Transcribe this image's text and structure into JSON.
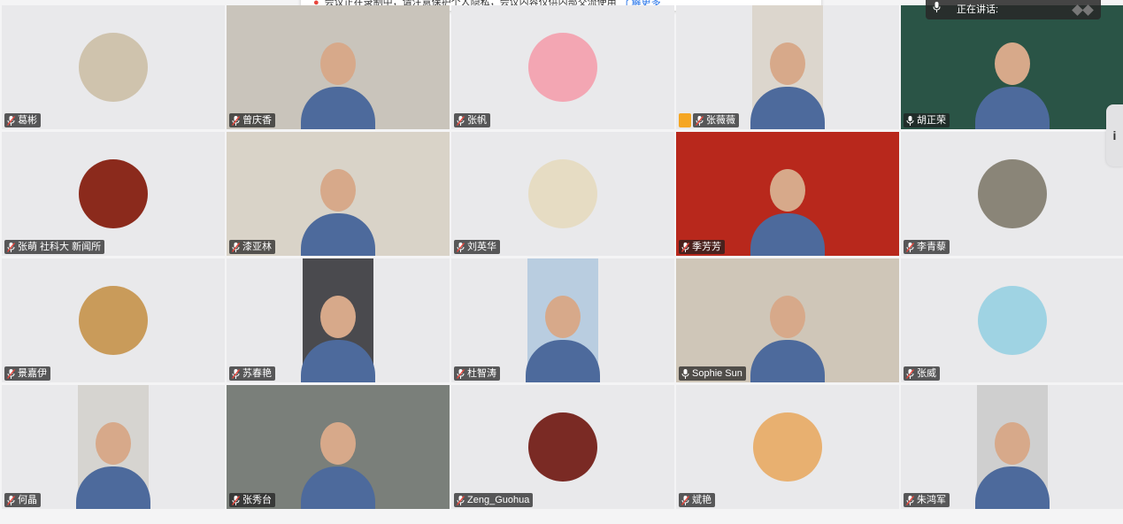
{
  "banner": {
    "text": "会议正在录制中，请注意保护个人隐私，会议内容仅供内部交流使用",
    "link": "了解更多"
  },
  "speaking": {
    "label": "正在讲话:"
  },
  "side_handle": {
    "label": "i"
  },
  "colors": {
    "tile_bg": "#e9e9eb",
    "name_tag_bg": "#1e1e1e",
    "host_badge": "#f5a623",
    "banner_dot": "#e8453c"
  },
  "participants": [
    {
      "name": "葛彬",
      "mic": "muted",
      "display": "avatar",
      "color": "#cfc3ad"
    },
    {
      "name": "曾庆香",
      "mic": "muted",
      "display": "video",
      "color": "#c9c4bb"
    },
    {
      "name": "张帆",
      "mic": "muted",
      "display": "avatar",
      "color": "#f3a6b3"
    },
    {
      "name": "张薇薇",
      "mic": "muted",
      "display": "video-narrow",
      "color": "#dcd6cd",
      "host": true
    },
    {
      "name": "胡正荣",
      "mic": "on",
      "display": "video",
      "color": "#2a5446"
    },
    {
      "name": "张萌 社科大 新闻所",
      "mic": "muted",
      "display": "avatar",
      "color": "#8b2a1c"
    },
    {
      "name": "漆亚林",
      "mic": "muted",
      "display": "video",
      "color": "#d9d3c8"
    },
    {
      "name": "刘英华",
      "mic": "muted",
      "display": "avatar",
      "color": "#e6dcc3"
    },
    {
      "name": "季芳芳",
      "mic": "muted",
      "display": "video",
      "color": "#b8281c"
    },
    {
      "name": "李青藜",
      "mic": "muted",
      "display": "avatar",
      "color": "#8a8578"
    },
    {
      "name": "景嘉伊",
      "mic": "muted",
      "display": "avatar",
      "color": "#c99b5a"
    },
    {
      "name": "苏春艳",
      "mic": "muted",
      "display": "video-narrow",
      "color": "#4a4a4e"
    },
    {
      "name": "杜智涛",
      "mic": "muted",
      "display": "video-narrow",
      "color": "#b9cde0"
    },
    {
      "name": "Sophie Sun",
      "mic": "on",
      "display": "video",
      "color": "#cfc6b8"
    },
    {
      "name": "张威",
      "mic": "muted",
      "display": "avatar",
      "color": "#9fd3e3"
    },
    {
      "name": "何晶",
      "mic": "muted",
      "display": "video-narrow",
      "color": "#d6d4d0"
    },
    {
      "name": "张秀台",
      "mic": "muted",
      "display": "video",
      "color": "#7a7f7a"
    },
    {
      "name": "Zeng_Guohua",
      "mic": "muted",
      "display": "avatar",
      "color": "#7a2a24"
    },
    {
      "name": "斌艳",
      "mic": "muted",
      "display": "avatar",
      "color": "#e8b070"
    },
    {
      "name": "朱鸿军",
      "mic": "muted",
      "display": "video-narrow",
      "color": "#cfcfcf"
    }
  ]
}
